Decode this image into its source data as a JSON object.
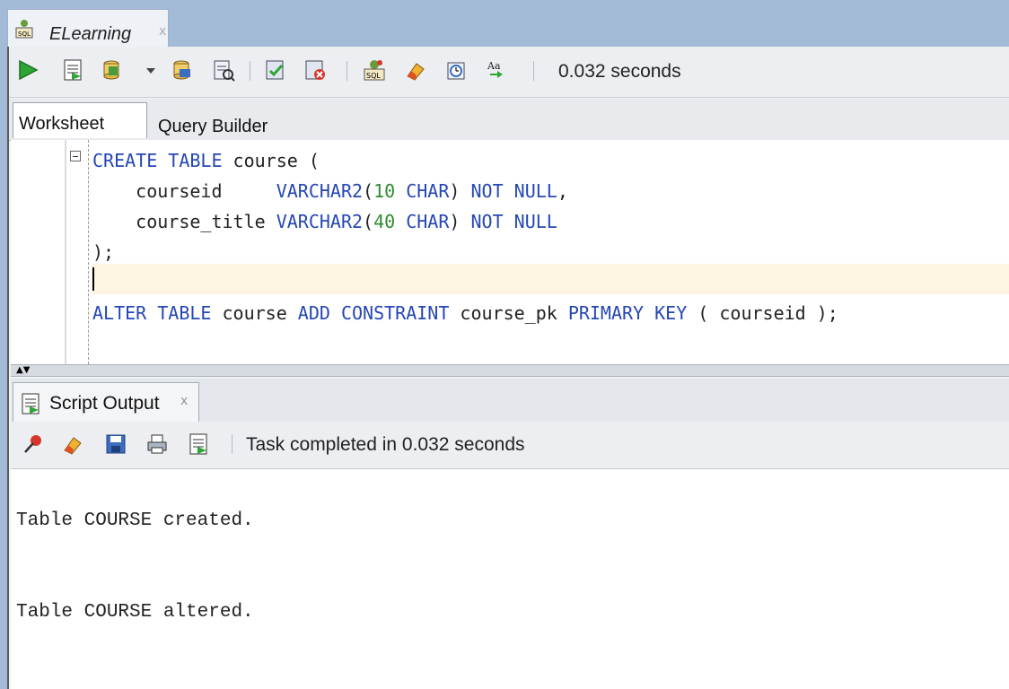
{
  "document_tab": {
    "label": "ELearning",
    "close": "x",
    "icon": "sql-connection-icon"
  },
  "toolbar": {
    "buttons": [
      "run-statement-icon",
      "run-script-icon",
      "commit-icon",
      "dropdown-arrow-icon",
      "rollback-icon",
      "explain-plan-icon",
      "autotrace-icon",
      "clear-icon",
      "sql-history-icon",
      "eraser-icon",
      "clock-icon",
      "format-icon"
    ],
    "elapsed": "0.032 seconds"
  },
  "tabs": {
    "worksheet": "Worksheet",
    "query_builder": "Query Builder"
  },
  "editor": {
    "lines": [
      {
        "segments": [
          {
            "t": "CREATE TABLE",
            "c": "kw"
          },
          {
            "t": " course (",
            "c": ""
          }
        ]
      },
      {
        "segments": [
          {
            "t": "    courseid     ",
            "c": ""
          },
          {
            "t": "VARCHAR2",
            "c": "kw"
          },
          {
            "t": "(",
            "c": ""
          },
          {
            "t": "10",
            "c": "num"
          },
          {
            "t": " ",
            "c": ""
          },
          {
            "t": "CHAR",
            "c": "kw"
          },
          {
            "t": ") ",
            "c": ""
          },
          {
            "t": "NOT NULL",
            "c": "kw"
          },
          {
            "t": ",",
            "c": ""
          }
        ]
      },
      {
        "segments": [
          {
            "t": "    course_title ",
            "c": ""
          },
          {
            "t": "VARCHAR2",
            "c": "kw"
          },
          {
            "t": "(",
            "c": ""
          },
          {
            "t": "40",
            "c": "num"
          },
          {
            "t": " ",
            "c": ""
          },
          {
            "t": "CHAR",
            "c": "kw"
          },
          {
            "t": ") ",
            "c": ""
          },
          {
            "t": "NOT NULL",
            "c": "kw"
          }
        ]
      },
      {
        "segments": [
          {
            "t": ");",
            "c": ""
          }
        ]
      },
      {
        "segments": []
      },
      {
        "segments": [
          {
            "t": "ALTER TABLE",
            "c": "kw"
          },
          {
            "t": " course ",
            "c": ""
          },
          {
            "t": "ADD CONSTRAINT",
            "c": "kw"
          },
          {
            "t": " course_pk ",
            "c": ""
          },
          {
            "t": "PRIMARY KEY",
            "c": "kw"
          },
          {
            "t": " ( courseid );",
            "c": ""
          }
        ]
      }
    ]
  },
  "output_panel": {
    "tab_label": "Script Output",
    "tab_close": "x",
    "status": "Task completed in 0.032 seconds",
    "toolbar_icons": [
      "pin-icon",
      "eraser-icon",
      "save-icon",
      "print-icon",
      "script-icon"
    ],
    "lines": [
      "Table COURSE created.",
      "Table COURSE altered."
    ]
  },
  "colors": {
    "keyword": "#2547b4",
    "number": "#2e8b2e",
    "current_line": "#fdf5e2",
    "frame": "#a3bbd6"
  }
}
